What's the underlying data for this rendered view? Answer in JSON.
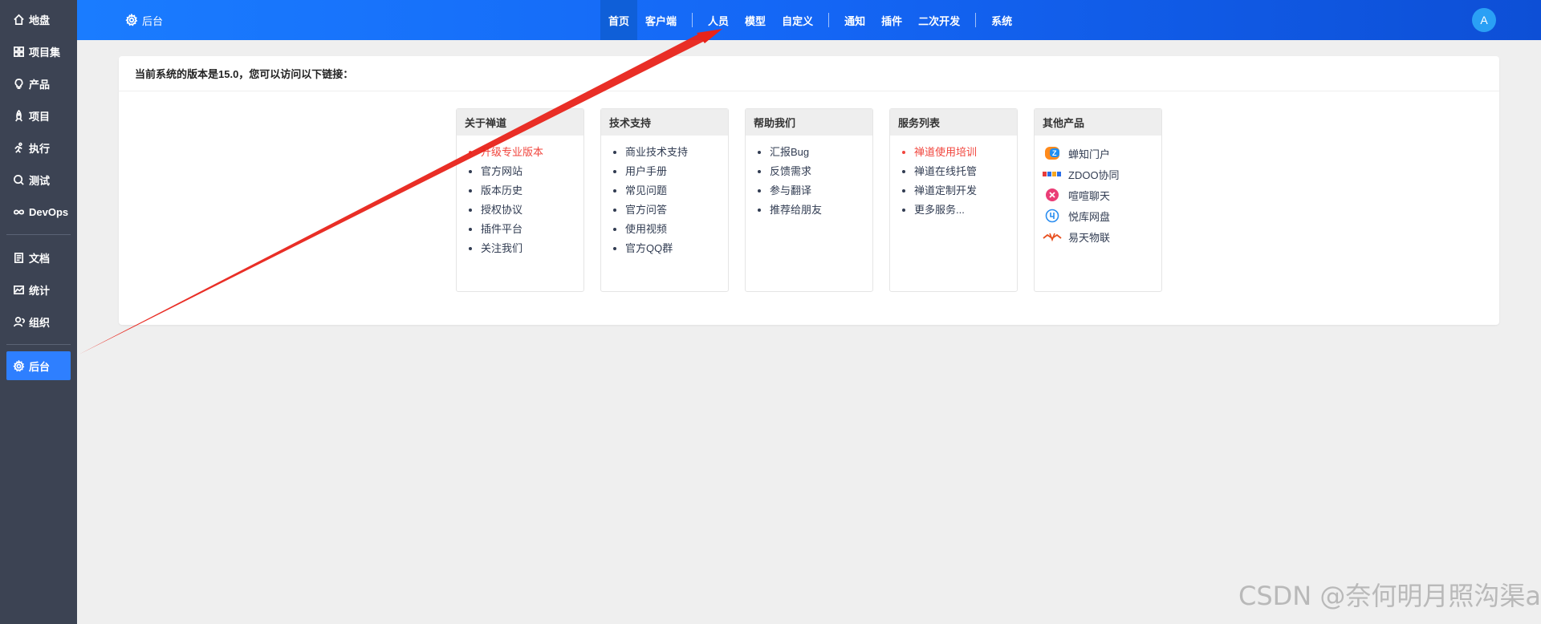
{
  "sidebar": {
    "items": [
      {
        "label": "地盘",
        "icon": "home-icon"
      },
      {
        "label": "项目集",
        "icon": "grid-icon"
      },
      {
        "label": "产品",
        "icon": "lightbulb-icon"
      },
      {
        "label": "项目",
        "icon": "rocket-icon"
      },
      {
        "label": "执行",
        "icon": "run-icon"
      },
      {
        "label": "测试",
        "icon": "magnify-icon"
      },
      {
        "label": "DevOps",
        "icon": "infinity-icon"
      },
      {
        "label": "文档",
        "icon": "doc-icon"
      },
      {
        "label": "统计",
        "icon": "chart-icon"
      },
      {
        "label": "组织",
        "icon": "people-icon"
      },
      {
        "label": "后台",
        "icon": "gear-icon"
      }
    ]
  },
  "header": {
    "title": "后台",
    "nav": [
      "首页",
      "客户端",
      "人员",
      "模型",
      "自定义",
      "通知",
      "插件",
      "二次开发",
      "系统"
    ],
    "avatar": "A"
  },
  "panel": {
    "heading": "当前系统的版本是15.0，您可以访问以下链接："
  },
  "cards": [
    {
      "title": "关于禅道",
      "items": [
        "升级专业版本",
        "官方网站",
        "版本历史",
        "授权协议",
        "插件平台",
        "关注我们"
      ]
    },
    {
      "title": "技术支持",
      "items": [
        "商业技术支持",
        "用户手册",
        "常见问题",
        "官方问答",
        "使用视频",
        "官方QQ群"
      ]
    },
    {
      "title": "帮助我们",
      "items": [
        "汇报Bug",
        "反馈需求",
        "参与翻译",
        "推荐给朋友"
      ]
    },
    {
      "title": "服务列表",
      "items": [
        "禅道使用培训",
        "禅道在线托管",
        "禅道定制开发",
        "更多服务..."
      ]
    },
    {
      "title": "其他产品",
      "items": [
        "蝉知门户",
        "ZDOO协同",
        "喧喧聊天",
        "悦库网盘",
        "易天物联"
      ]
    }
  ],
  "colors": {
    "sidebar_bg": "#3c4353",
    "header_start": "#1a7cff",
    "accent": "#2e7fff",
    "highlight_link": "#f1453d",
    "annotation_arrow": "#e8231a"
  },
  "watermark": "CSDN @奈何明月照沟渠a"
}
